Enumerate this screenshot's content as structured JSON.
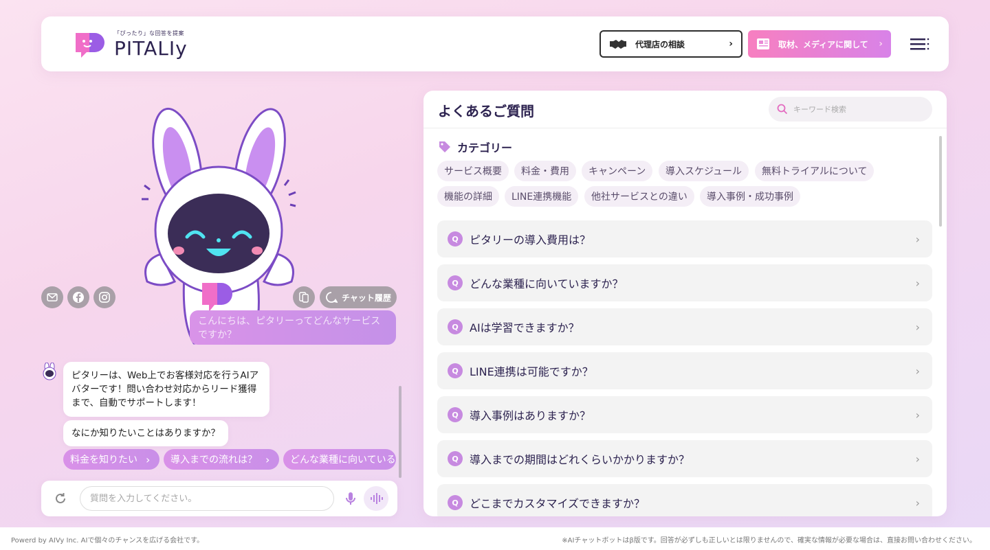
{
  "header": {
    "logo_tagline": "「ぴったり」な回答を提案",
    "logo_text": "PITALIy",
    "agency_button": "代理店の相談",
    "media_button": "取材、メディアに関して"
  },
  "chat": {
    "history_button": "チャット履歴",
    "user_message": "こんにちは、ピタリーってどんなサービスですか？",
    "bot_messages": [
      "ピタリーは、Web上でお客様対応を行うAIアバターです！問い合わせ対応からリード獲得まで、自動でサポートします！",
      "なにか知りたいことはありますか？"
    ],
    "suggestions": [
      "料金を知りたい",
      "導入までの流れは？",
      "どんな業種に向いている"
    ],
    "input_placeholder": "質問を入力してください。"
  },
  "faq": {
    "title": "よくあるご質問",
    "search_placeholder": "キーワード検索",
    "category_label": "カテゴリー",
    "categories": [
      "サービス概要",
      "料金・費用",
      "キャンペーン",
      "導入スケジュール",
      "無料トライアルについて",
      "機能の詳細",
      "LINE連携機能",
      "他社サービスとの違い",
      "導入事例・成功事例"
    ],
    "q_badge": "Q",
    "questions": [
      "ピタリーの導入費用は？",
      "どんな業種に向いていますか？",
      "AIは学習できますか？",
      "LINE連携は可能ですか？",
      "導入事例はありますか？",
      "導入までの期間はどれくらいかかりますか？",
      "どこまでカスタマイズできますか？"
    ]
  },
  "footer": {
    "left": "Powerd by AIVy Inc.  AIで個々のチャンスを広げる会社です。",
    "right": "※AIチャットボットはβ版です。回答が必ずしも正しいとは限りませんので、確実な情報が必要な場合は、直接お問い合わせください。"
  },
  "colors": {
    "accent_pink": "#f77fc0",
    "accent_purple": "#c78ae0",
    "text_dark": "#2d2350"
  }
}
